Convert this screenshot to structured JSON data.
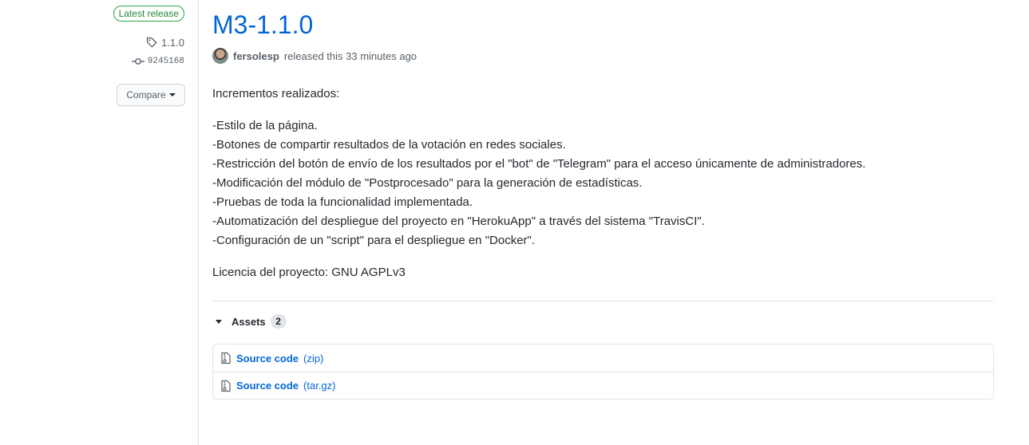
{
  "meta": {
    "latest_badge": "Latest release",
    "tag": "1.1.0",
    "commit": "9245168",
    "compare_label": "Compare",
    "icons": {
      "tag": "tag-icon",
      "commit": "git-commit-icon",
      "caret": "caret-down-icon"
    }
  },
  "release": {
    "title": "M3-1.1.0",
    "author": "fersolesp",
    "released_text": "released this 33 minutes ago"
  },
  "body": {
    "intro": "Incrementos realizados:",
    "items": [
      "-Estilo de la página.",
      "-Botones de compartir resultados de la votación en redes sociales.",
      "-Restricción del botón de envío de los resultados por el \"bot\" de \"Telegram\" para el acceso únicamente de administradores.",
      "-Modificación del módulo de \"Postprocesado\" para la generación de estadísticas.",
      "-Pruebas de toda la funcionalidad implementada.",
      "-Automatización del despliegue del proyecto en \"HerokuApp\" a través del sistema \"TravisCI\".",
      "-Configuración de un \"script\" para el despliegue en \"Docker\"."
    ],
    "license": "Licencia del proyecto: GNU AGPLv3"
  },
  "assets": {
    "label": "Assets",
    "count": "2",
    "items": [
      {
        "name": "Source code",
        "ext": "(zip)",
        "icon": "file-zip-icon"
      },
      {
        "name": "Source code",
        "ext": "(tar.gz)",
        "icon": "file-zip-icon"
      }
    ]
  },
  "colors": {
    "link": "#0366d6",
    "success": "#28a745",
    "muted": "#586069",
    "border": "#e1e4e8"
  }
}
